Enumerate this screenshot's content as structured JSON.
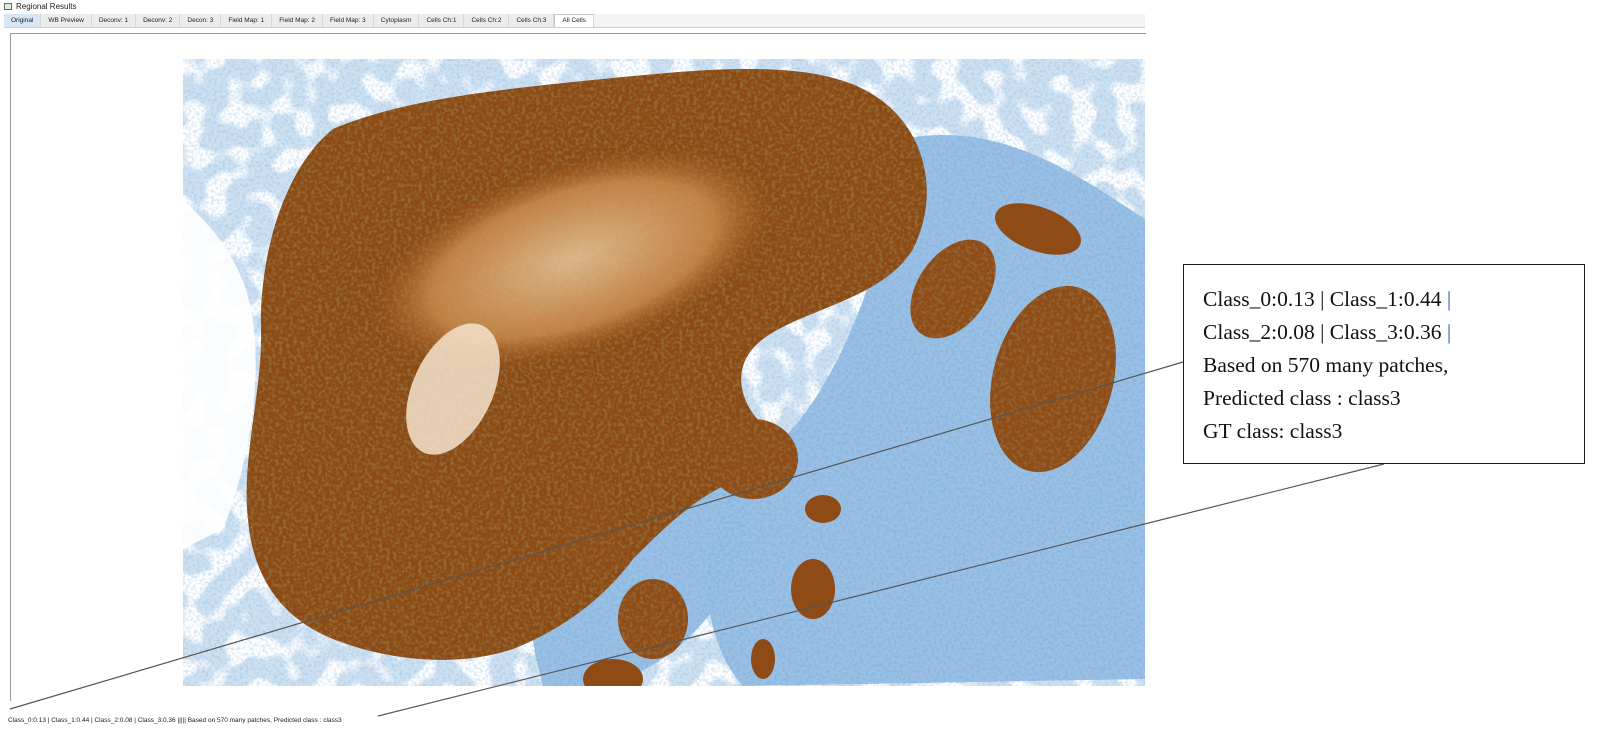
{
  "window": {
    "title": "Regional Results",
    "icon": "window-icon"
  },
  "tabs": [
    {
      "label": "Original"
    },
    {
      "label": "WB Preview"
    },
    {
      "label": "Deconv: 1"
    },
    {
      "label": "Deconv: 2"
    },
    {
      "label": "Decon: 3"
    },
    {
      "label": "Field Map: 1"
    },
    {
      "label": "Field Map: 2"
    },
    {
      "label": "Field Map: 3"
    },
    {
      "label": "Cytoplasm"
    },
    {
      "label": "Cells Ch:1"
    },
    {
      "label": "Cells Ch:2"
    },
    {
      "label": "Cells Ch:3"
    },
    {
      "label": "All Cells"
    }
  ],
  "active_tab": "All Cells",
  "annotation": {
    "class0": "Class_0:0.13",
    "class1": "Class_1:0.44",
    "class2": "Class_2:0.08",
    "class3": "Class_3:0.36",
    "separator": "|",
    "patches": "Based on 570 many patches,",
    "predicted": "Predicted class : class3",
    "gt": "GT class: class3"
  },
  "status_bar": {
    "text": "Class_0:0.13  |  Class_1:0.44  |  Class_2:0.08  |  Class_3:0.36    |||||    Based on 570 many patches, Predicted class : class3"
  },
  "colors": {
    "stain_brown": "#8b4a14",
    "hematoxylin_blue": "#3f7cc0",
    "background_blue": "#c7dcef"
  }
}
